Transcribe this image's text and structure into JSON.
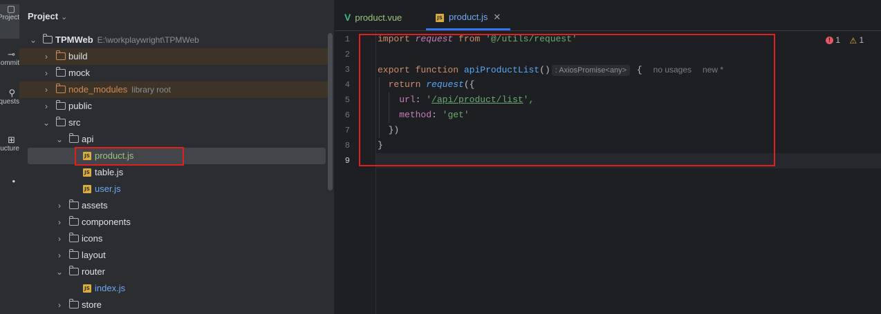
{
  "toolstrip": {
    "items": [
      {
        "icon": "project-icon",
        "glyph": "▢",
        "label": "Project"
      },
      {
        "icon": "commit-icon",
        "glyph": "⊸",
        "label": "Commit"
      },
      {
        "icon": "pull-requests-icon",
        "glyph": "⚲",
        "label": "Pull Requests"
      },
      {
        "icon": "structure-icon",
        "glyph": "⊞",
        "label": "Structure"
      },
      {
        "icon": "more-icon",
        "glyph": "•",
        "label": ""
      }
    ]
  },
  "project": {
    "title": "Project",
    "root": {
      "name": "TPMWeb",
      "path": "E:\\workplaywright\\TPMWeb"
    },
    "nodes": [
      {
        "label": "build",
        "hint": ""
      },
      {
        "label": "mock",
        "hint": ""
      },
      {
        "label": "node_modules",
        "hint": "library root"
      },
      {
        "label": "public",
        "hint": ""
      },
      {
        "label": "src",
        "hint": ""
      },
      {
        "label": "api",
        "hint": ""
      },
      {
        "label": "product.js",
        "hint": ""
      },
      {
        "label": "table.js",
        "hint": ""
      },
      {
        "label": "user.js",
        "hint": ""
      },
      {
        "label": "assets",
        "hint": ""
      },
      {
        "label": "components",
        "hint": ""
      },
      {
        "label": "icons",
        "hint": ""
      },
      {
        "label": "layout",
        "hint": ""
      },
      {
        "label": "router",
        "hint": ""
      },
      {
        "label": "index.js",
        "hint": ""
      },
      {
        "label": "store",
        "hint": ""
      }
    ]
  },
  "editor": {
    "tabs": [
      {
        "label": "product.vue",
        "active": false
      },
      {
        "label": "product.js",
        "active": true
      }
    ],
    "problems": {
      "errors": "1",
      "warnings": "1"
    },
    "line_numbers": [
      "1",
      "2",
      "3",
      "4",
      "5",
      "6",
      "7",
      "8",
      "9"
    ],
    "code": {
      "l1_kw": "import",
      "l1_name": "request",
      "l1_from": "from",
      "l1_str": "'@/utils/request'",
      "l3_export": "export",
      "l3_function": "function",
      "l3_name": "apiProductList",
      "l3_parens": "()",
      "l3_type": ": AxiosPromise<any>",
      "l3_brace": "{",
      "l3_usages": "no usages",
      "l3_new": "new *",
      "l4_return": "return",
      "l4_call": "request",
      "l4_paren": "({",
      "l5_key": "url",
      "l5_colon": ": ",
      "l5_q1": "'",
      "l5_val": "/api/product/list",
      "l5_q2": "',",
      "l6_key": "method",
      "l6_colon": ": ",
      "l6_val": "'get'",
      "l7": "})",
      "l8": "}"
    }
  },
  "colors": {
    "highlight": "#e0201c",
    "accent": "#3574f0"
  }
}
